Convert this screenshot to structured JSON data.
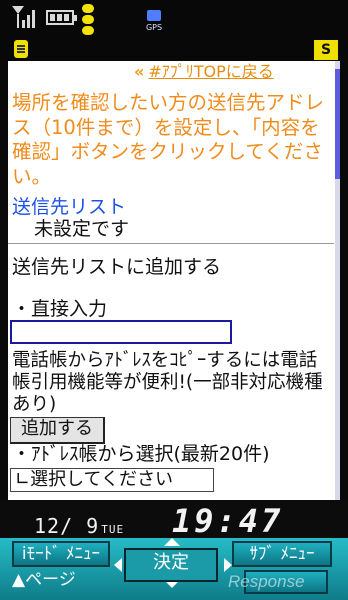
{
  "status": {
    "signal_icon": "signal-icon",
    "battery_icon": "battery-icon",
    "gps_label": "GPS",
    "mail_icon": "mail-icon",
    "s_badge": "S"
  },
  "page": {
    "top_link_arrow": "«",
    "top_link": "#ｱﾌﾟﾘTOPに戻る",
    "instruction": "場所を確認したい方の送信先アドレス（10件まで）を設定し、「内容を確認」ボタンをクリックしてください。",
    "recipient_list_title": "送信先リスト",
    "recipient_list_empty": "未設定です",
    "add_heading": "送信先リストに追加する",
    "direct_input_label": "・直接入力",
    "direct_input_value": "",
    "note": "電話帳からｱﾄﾞﾚｽをｺﾋﾟｰするには電話帳引用機能等が便利!(一部非対応機種あり)",
    "add_button": "追加する",
    "addressbook_label": "・ｱﾄﾞﾚｽ帳から選択(最新20件)",
    "select_value": "∟選択してください"
  },
  "clock": {
    "date": "12/ 9",
    "weekday": "TUE",
    "time": "19:47"
  },
  "softkeys": {
    "left_top": "iﾓｰﾄﾞ ﾒﾆｭｰ",
    "left_bottom": "▲ページ",
    "center": "決定",
    "right_top": "ｻﾌﾞ ﾒﾆｭｰ"
  },
  "watermark": "Response",
  "colors": {
    "instruction": "#f08c1c",
    "list_title": "#1c52e8",
    "softkey_bg": "#1fb0c0",
    "input_border": "#1a1a9e"
  }
}
